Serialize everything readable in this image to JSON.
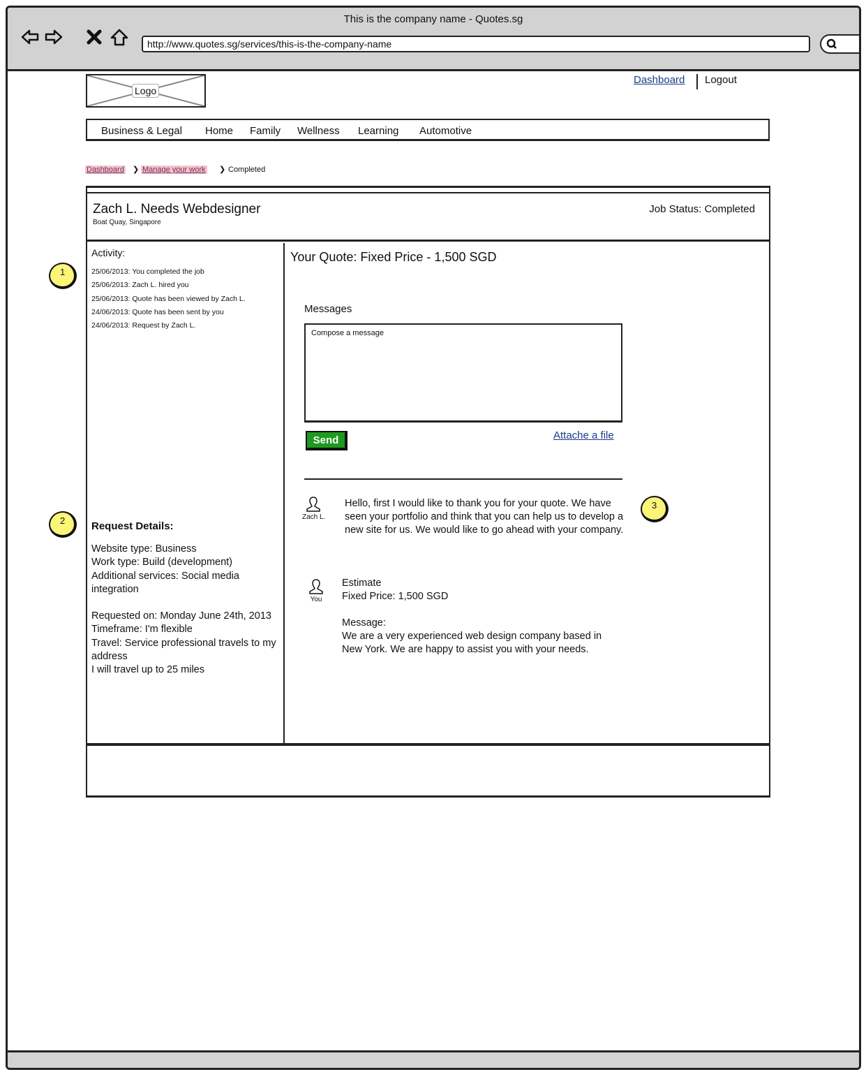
{
  "browser": {
    "window_title": "This is the company name - Quotes.sg",
    "url": "http://www.quotes.sg/services/this-is-the-company-name"
  },
  "header": {
    "logo_label": "Logo",
    "dashboard_label": "Dashboard",
    "logout_label": "Logout"
  },
  "nav": {
    "items": [
      "Business & Legal",
      "Home",
      "Family",
      "Wellness",
      "Learning",
      "Automotive"
    ]
  },
  "breadcrumb": {
    "items": [
      "Dashboard",
      "Manage your work",
      "Completed"
    ]
  },
  "job": {
    "title": "Zach L. Needs Webdesigner",
    "location": "Boat Quay, Singapore",
    "status": "Job Status: Completed"
  },
  "activity": {
    "heading": "Activity:",
    "items": [
      "25/06/2013: You completed the job",
      "25/06/2013: Zach L. hired you",
      "25/06/2013: Quote has been viewed by Zach L.",
      "24/06/2013: Quote has been sent by you",
      "24/06/2013: Request by Zach L."
    ]
  },
  "request": {
    "heading": "Request Details:",
    "website_type": "Website type: Business",
    "work_type": "Work type: Build (development)",
    "additional_services": "Additional services: Social media integration",
    "requested_on": "Requested on: Monday June 24th, 2013",
    "timeframe": "Timeframe: I'm flexible",
    "travel": "Travel: Service professional travels to my address",
    "travel_distance": "I will travel up to 25 miles"
  },
  "quote": {
    "title": "Your Quote: Fixed Price - 1,500 SGD"
  },
  "messages": {
    "heading": "Messages",
    "compose_placeholder": "Compose a message",
    "send_label": "Send",
    "attach_label": "Attache a file",
    "thread": [
      {
        "author": "Zach L.",
        "text": "Hello, first I would like to thank you for your quote. We have seen your portfolio and think that you can help us to develop a new site for us. We would like to go ahead with your company."
      },
      {
        "author": "You",
        "estimate_label": "Estimate",
        "fixed_price": "Fixed Price: 1,500 SGD",
        "message_label": "Message:",
        "text": "We are a very experienced web design company based in New York. We are happy to assist you with your needs."
      }
    ]
  },
  "annotations": [
    "1",
    "2",
    "3"
  ],
  "colors": {
    "send_button": "#1e9a1e",
    "link": "#1a3a8a",
    "breadcrumb_highlight": "#f2c6c6",
    "annotation_marker": "#fbf57a",
    "chrome": "#d2d2d2"
  }
}
